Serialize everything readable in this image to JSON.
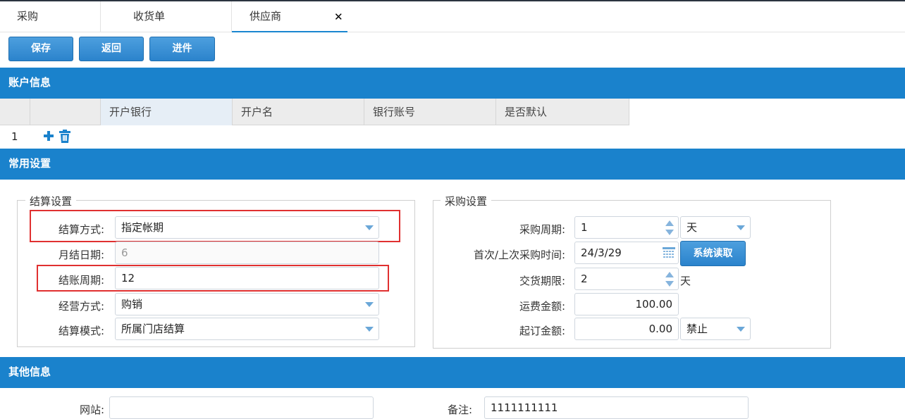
{
  "tabs": [
    "采购",
    "收货单",
    "供应商"
  ],
  "toolbar": {
    "save": "保存",
    "back": "返回",
    "stock_in": "进件"
  },
  "sections": {
    "account": "账户信息",
    "common": "常用设置",
    "other": "其他信息"
  },
  "account_grid": {
    "columns": [
      "开户银行",
      "开户名",
      "银行账号",
      "是否默认"
    ],
    "row_number": "1"
  },
  "settlement": {
    "legend": "结算设置",
    "method_label": "结算方式:",
    "method_value": "指定帐期",
    "monthly_day_label": "月结日期:",
    "monthly_day_value": "6",
    "period_label": "结账周期:",
    "period_value": "12",
    "business_label": "经营方式:",
    "business_value": "购销",
    "mode_label": "结算模式:",
    "mode_value": "所属门店结算"
  },
  "purchase": {
    "legend": "采购设置",
    "cycle_label": "采购周期:",
    "cycle_value": "1",
    "cycle_unit": "天",
    "time_label": "首次/上次采购时间:",
    "time_value": "24/3/29",
    "read_button": "系统读取",
    "delivery_label": "交货期限:",
    "delivery_value": "2",
    "delivery_unit": "天",
    "freight_label": "运费金额:",
    "freight_value": "100.00",
    "min_order_label": "起订金额:",
    "min_order_value": "0.00",
    "min_order_mode": "禁止"
  },
  "other": {
    "website_label": "网站:",
    "website_value": "",
    "remark_label": "备注:",
    "remark_value": "1111111111"
  },
  "colors": {
    "accent": "#1a82cc",
    "highlight": "#e03030"
  }
}
